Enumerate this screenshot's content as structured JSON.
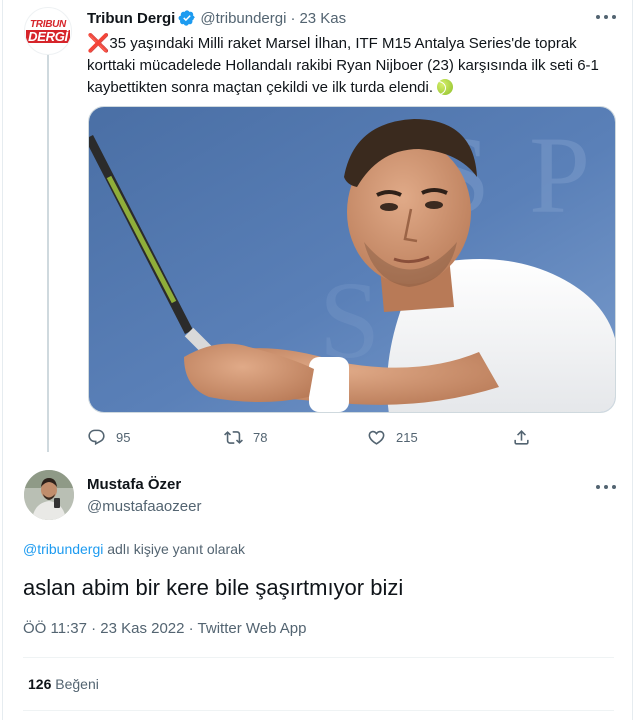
{
  "parent_tweet": {
    "avatar_top": "TRIBUN",
    "avatar_bottom": "DERGİ",
    "name": "Tribun Dergi",
    "handle": "@tribundergi",
    "separator": "·",
    "time": "23 Kas",
    "emoji_cross": "❌",
    "text": "35 yaşındaki Milli raket Marsel İlhan, ITF M15 Antalya Series'de toprak korttaki mücadelede Hollandalı rakibi Ryan Nijboer (23) karşısında ilk seti 6-1 kaybettikten sonra maçtan çekildi ve ilk turda elendi.",
    "emoji_tennis": "tennis-ball",
    "actions": {
      "reply_count": "95",
      "retweet_count": "78",
      "like_count": "215"
    }
  },
  "reply_tweet": {
    "name": "Mustafa Özer",
    "handle": "@mustafaaozeer",
    "reply_mention": "@tribundergi",
    "reply_suffix": " adlı kişiye yanıt olarak",
    "text": "aslan abim bir kere bile şaşırtmıyor bizi",
    "meta": "ÖÖ 11:37 · 23 Kas 2022 · Twitter Web App",
    "likes_count": "126",
    "likes_label": " Beğeni"
  },
  "colors": {
    "text_primary": "#0f1419",
    "text_secondary": "#536471",
    "link": "#1d9bf0",
    "verified": "#1d9bf0",
    "brand_red": "#d6242a"
  }
}
